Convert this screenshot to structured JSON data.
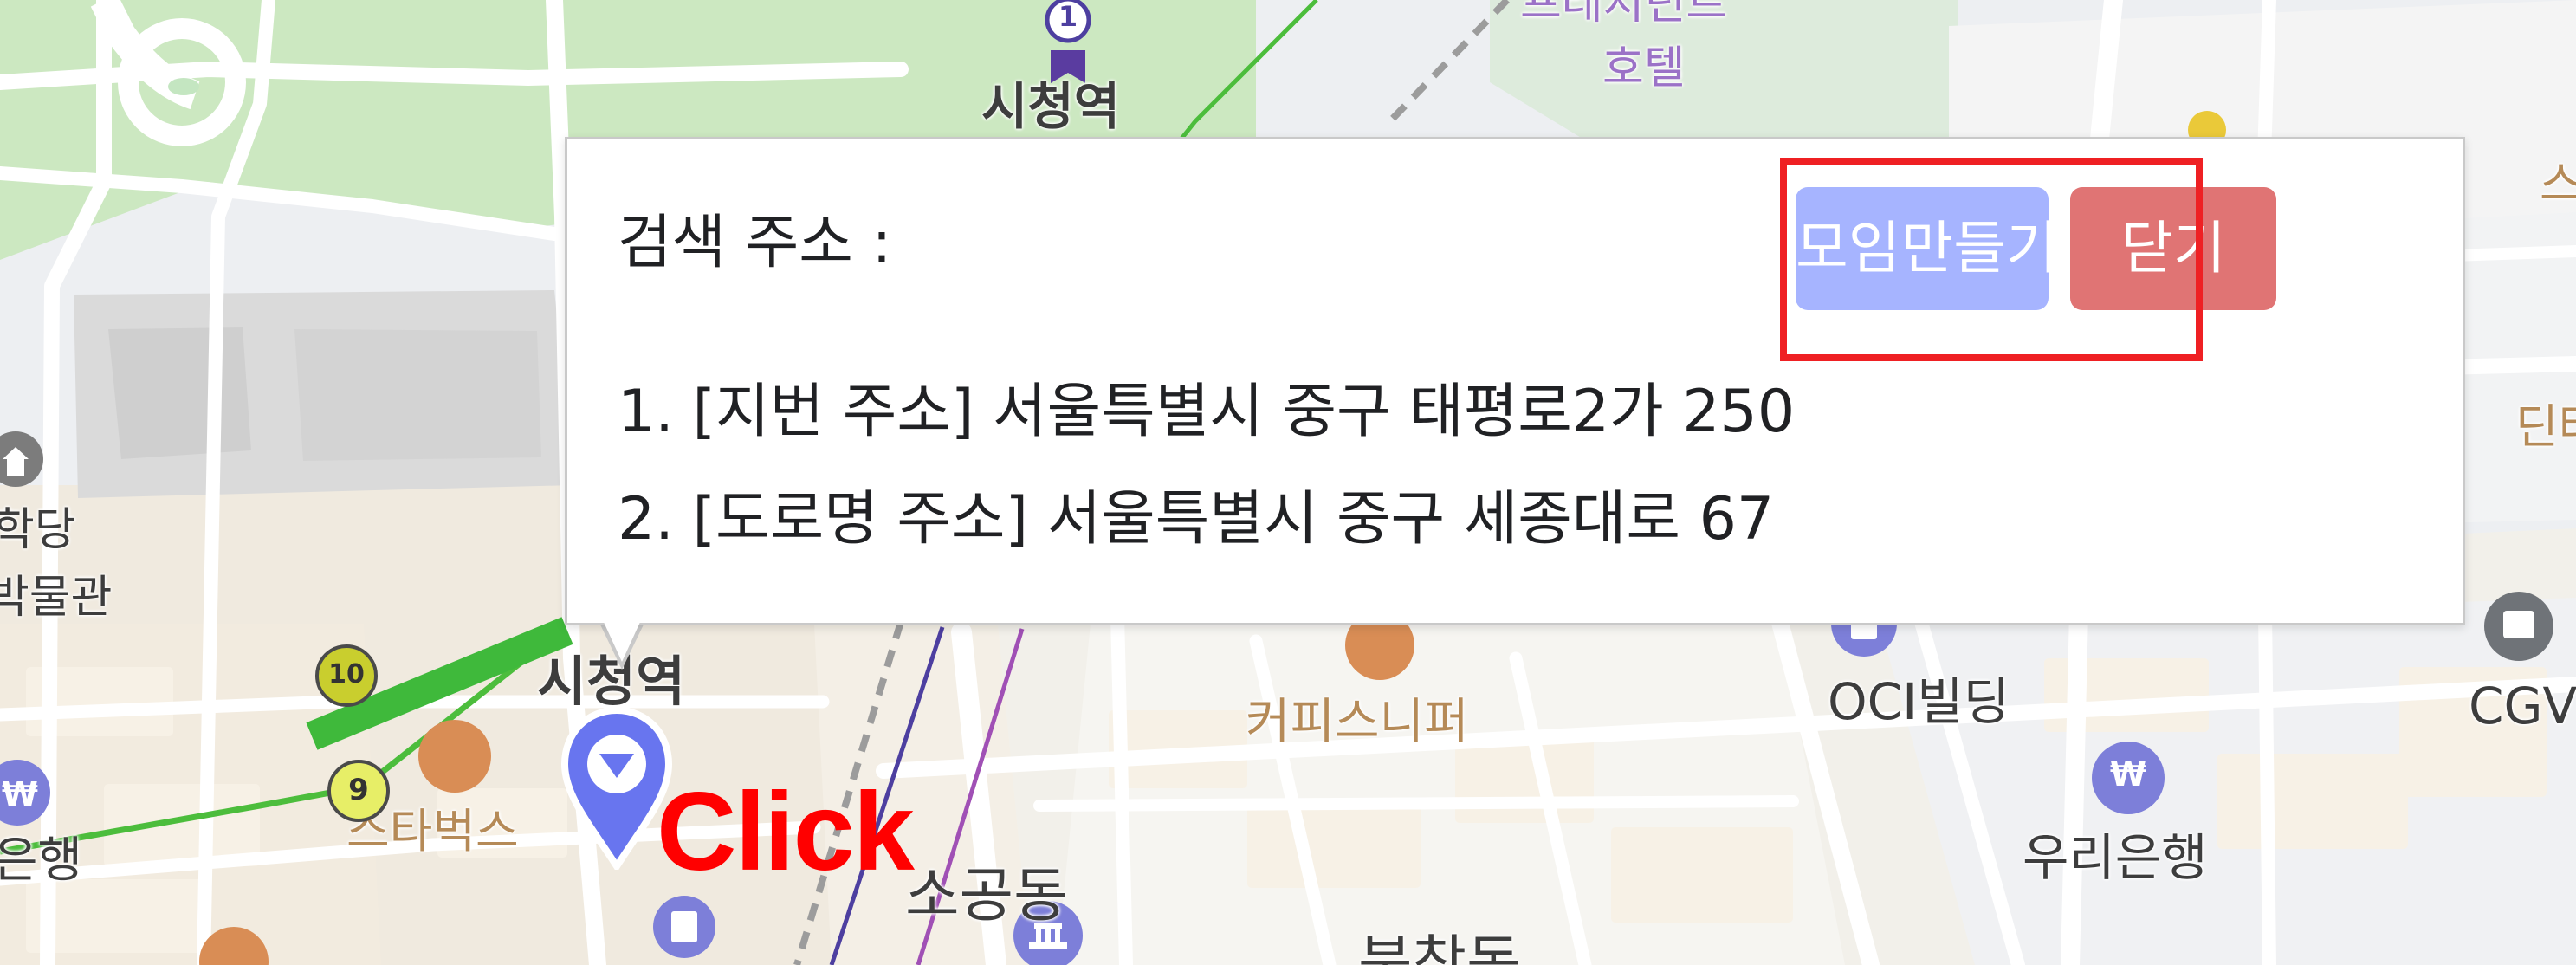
{
  "popup": {
    "search_label": "검색 주소 :",
    "meeting_button": "모임만들기",
    "close_button": "닫기",
    "address_lines": [
      "1. [지번 주소] 서울특별시 중구 태평로2가 250",
      "2. [도로명 주소] 서울특별시 중구 세종대로 67"
    ]
  },
  "annotation": {
    "click_text": "Click"
  },
  "map": {
    "labels": {
      "city_hall_station_top": "시청역",
      "hotel_line_1": "프레지던트",
      "hotel_line_2": "호텔",
      "school_fragment": "학당",
      "museum_fragment": "박물관",
      "city_hall_station_lower": "시청역",
      "starbucks": "스타벅스",
      "coffee_snipper": "커피스니퍼",
      "oci_building": "OCI빌딩",
      "woori_bank": "우리은행",
      "cgv": "CGV",
      "bank_fragment": "은행",
      "sogong_dong": "소공동",
      "bukchang_dong": "북창동",
      "right_fragment_1": "스",
      "right_fragment_2": "딘타"
    },
    "badges": {
      "line_1": "1",
      "line_10": "10",
      "line_9": "9",
      "won_sign": "₩"
    },
    "colors": {
      "park": "#c9e7c0",
      "land": "#f0ece2",
      "block": "#f6f1ea",
      "road": "#ffffff",
      "railway": "#9b9b9b",
      "green_line": "#4cbd3c",
      "metro_blue": "#4d3fa0",
      "marker": "#6875ef",
      "popup_button": "#a6b4ff",
      "close_button": "#e07474",
      "highlight": "#ef2023",
      "click": "#ff0000"
    },
    "icons": [
      "subway-station-icon",
      "coffee-icon",
      "bank-icon",
      "building-icon",
      "museum-icon",
      "movie-icon",
      "location-marker-icon"
    ]
  }
}
